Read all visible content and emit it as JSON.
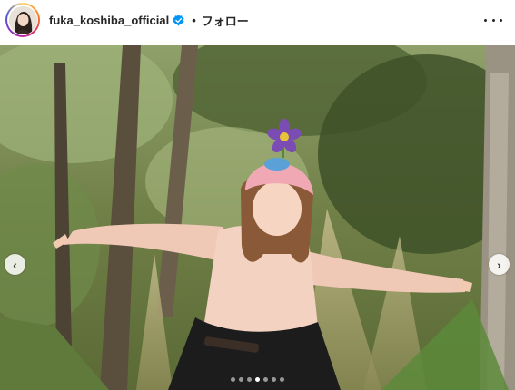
{
  "post": {
    "username": "fuka_koshiba_official",
    "verified": true,
    "separator": "•",
    "follow_label": "フォロー",
    "more_icon": "more-horizontal-icon"
  },
  "carousel": {
    "prev_icon": "chevron-left-icon",
    "next_icon": "chevron-right-icon",
    "prev_glyph": "‹",
    "next_glyph": "›",
    "slide_count": 7,
    "active_index": 3
  },
  "colors": {
    "verified_badge": "#0095f6",
    "text": "#262626"
  }
}
